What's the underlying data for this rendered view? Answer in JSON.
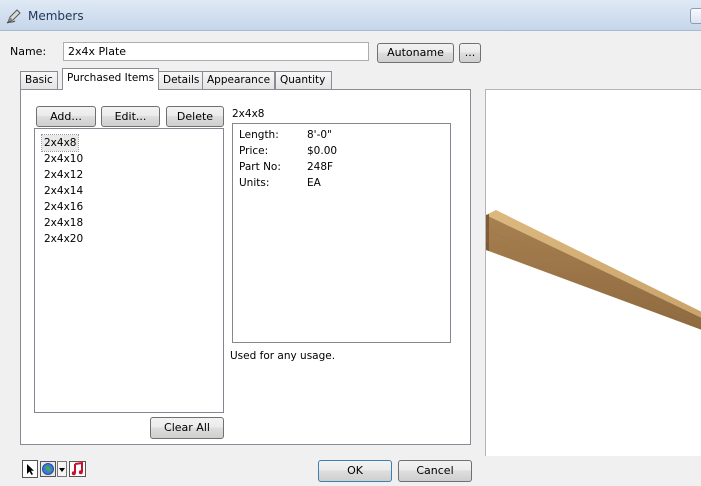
{
  "window": {
    "title": "Members"
  },
  "name_row": {
    "label": "Name:",
    "value": "2x4x Plate",
    "autoname_label": "Autoname",
    "ellipsis_label": "..."
  },
  "tabs": [
    {
      "label": "Basic",
      "active": false
    },
    {
      "label": "Purchased Items",
      "active": true
    },
    {
      "label": "Details",
      "active": false
    },
    {
      "label": "Appearance",
      "active": false
    },
    {
      "label": "Quantity",
      "active": false
    }
  ],
  "items_panel": {
    "add_label": "Add...",
    "edit_label": "Edit...",
    "delete_label": "Delete",
    "clear_label": "Clear All",
    "items": [
      "2x4x8",
      "2x4x10",
      "2x4x12",
      "2x4x14",
      "2x4x16",
      "2x4x18",
      "2x4x20"
    ],
    "selected": "2x4x8"
  },
  "details": {
    "title": "2x4x8",
    "properties": [
      {
        "label": "Length:",
        "value": "8'-0\""
      },
      {
        "label": "Price:",
        "value": "$0.00"
      },
      {
        "label": "Part No:",
        "value": "248F"
      },
      {
        "label": "Units:",
        "value": "EA"
      }
    ],
    "usage": "Used for any usage."
  },
  "footer": {
    "ok_label": "OK",
    "cancel_label": "Cancel"
  },
  "icons": [
    "pencil-brush-icon",
    "select-page-icon",
    "globe-icon",
    "dropdown-arrow-icon",
    "music-note-icon"
  ],
  "colors": {
    "lumber": "#c9a36a",
    "ok_border": "#3c7fb1"
  }
}
